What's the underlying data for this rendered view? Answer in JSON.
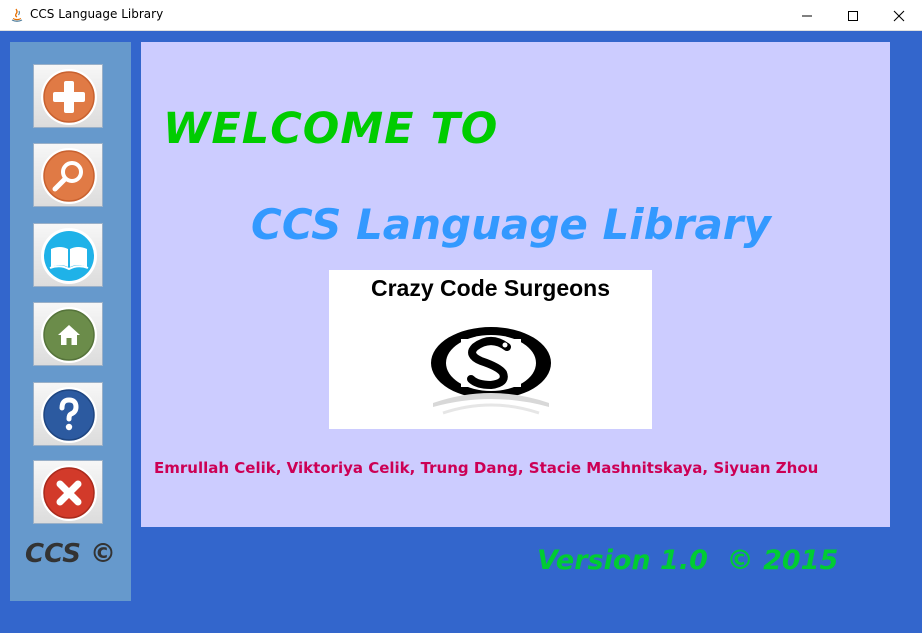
{
  "window": {
    "title": "CCS Language Library",
    "controls": [
      "minimize-icon",
      "maximize-icon",
      "close-icon"
    ]
  },
  "sidebar": {
    "buttons": [
      {
        "icon": "add-icon",
        "color": "#e07a45"
      },
      {
        "icon": "search-icon",
        "color": "#e07a45"
      },
      {
        "icon": "book-icon",
        "color": "#1fb2e8"
      },
      {
        "icon": "home-icon",
        "color": "#6b8c4a"
      },
      {
        "icon": "help-icon",
        "color": "#2c5aa0"
      },
      {
        "icon": "exit-icon",
        "color": "#d23a2a"
      }
    ],
    "footer": "CCS ©"
  },
  "main": {
    "welcome": "WELCOME TO",
    "app_name": "CCS Language Library",
    "logo_text": "Crazy Code Surgeons",
    "authors": "Emrullah Celik, Viktoriya Celik, Trung Dang, Stacie Mashnitskaya, Siyuan Zhou"
  },
  "version_text": "Version 1.0  © 2015",
  "colors": {
    "background": "#3366cc",
    "sidebar": "#6699cc",
    "panel": "#ccccff",
    "welcome": "#00cc00",
    "app_name": "#3399ff",
    "authors": "#cc0055",
    "version": "#00cc33"
  }
}
